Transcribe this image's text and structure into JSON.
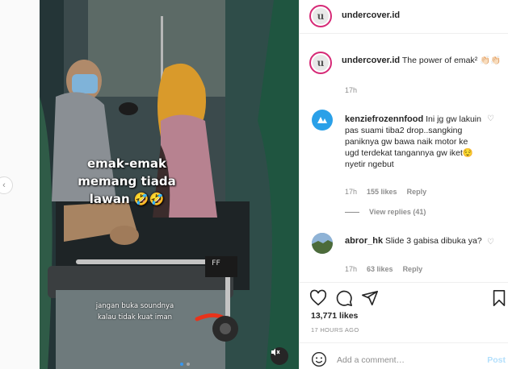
{
  "post": {
    "author": "undercover.id",
    "caption_text": "The power of emak² 👏🏻👏🏻",
    "caption_time": "17h"
  },
  "video": {
    "caption_lines": [
      "emak-emak",
      "memang tiada",
      "lawan 🤣🤣"
    ],
    "subtitle_lines": [
      "jangan buka soundnya",
      "kalau tidak kuat iman"
    ],
    "plate_text": "FF"
  },
  "comments": [
    {
      "username": "kenziefrozennfood",
      "text": "Ini jg gw lakuin pas suami tiba2 drop..sangking paniknya gw bawa naik motor ke ugd terdekat tangannya gw iket😌nyetir ngebut",
      "time": "17h",
      "likes": "155 likes",
      "reply": "Reply",
      "view_replies": "View replies (41)"
    },
    {
      "username": "abror_hk",
      "text": "Slide 3 gabisa dibuka ya?",
      "time": "17h",
      "likes": "63 likes",
      "reply": "Reply"
    }
  ],
  "stats": {
    "likes": "13,771 likes",
    "time_ago": "17 HOURS AGO"
  },
  "composer": {
    "placeholder": "Add a comment…",
    "post_label": "Post"
  },
  "icons": {
    "like": "heart-icon",
    "comment": "comment-icon",
    "share": "share-icon",
    "save": "bookmark-icon",
    "emoji": "emoji-icon",
    "mute": "speaker-muted-icon",
    "prev": "chevron-left-icon"
  },
  "colors": {
    "story_ring": "#d62976",
    "post_button_disabled": "#b2dffc",
    "carousel_dot_active": "#3897f0"
  }
}
